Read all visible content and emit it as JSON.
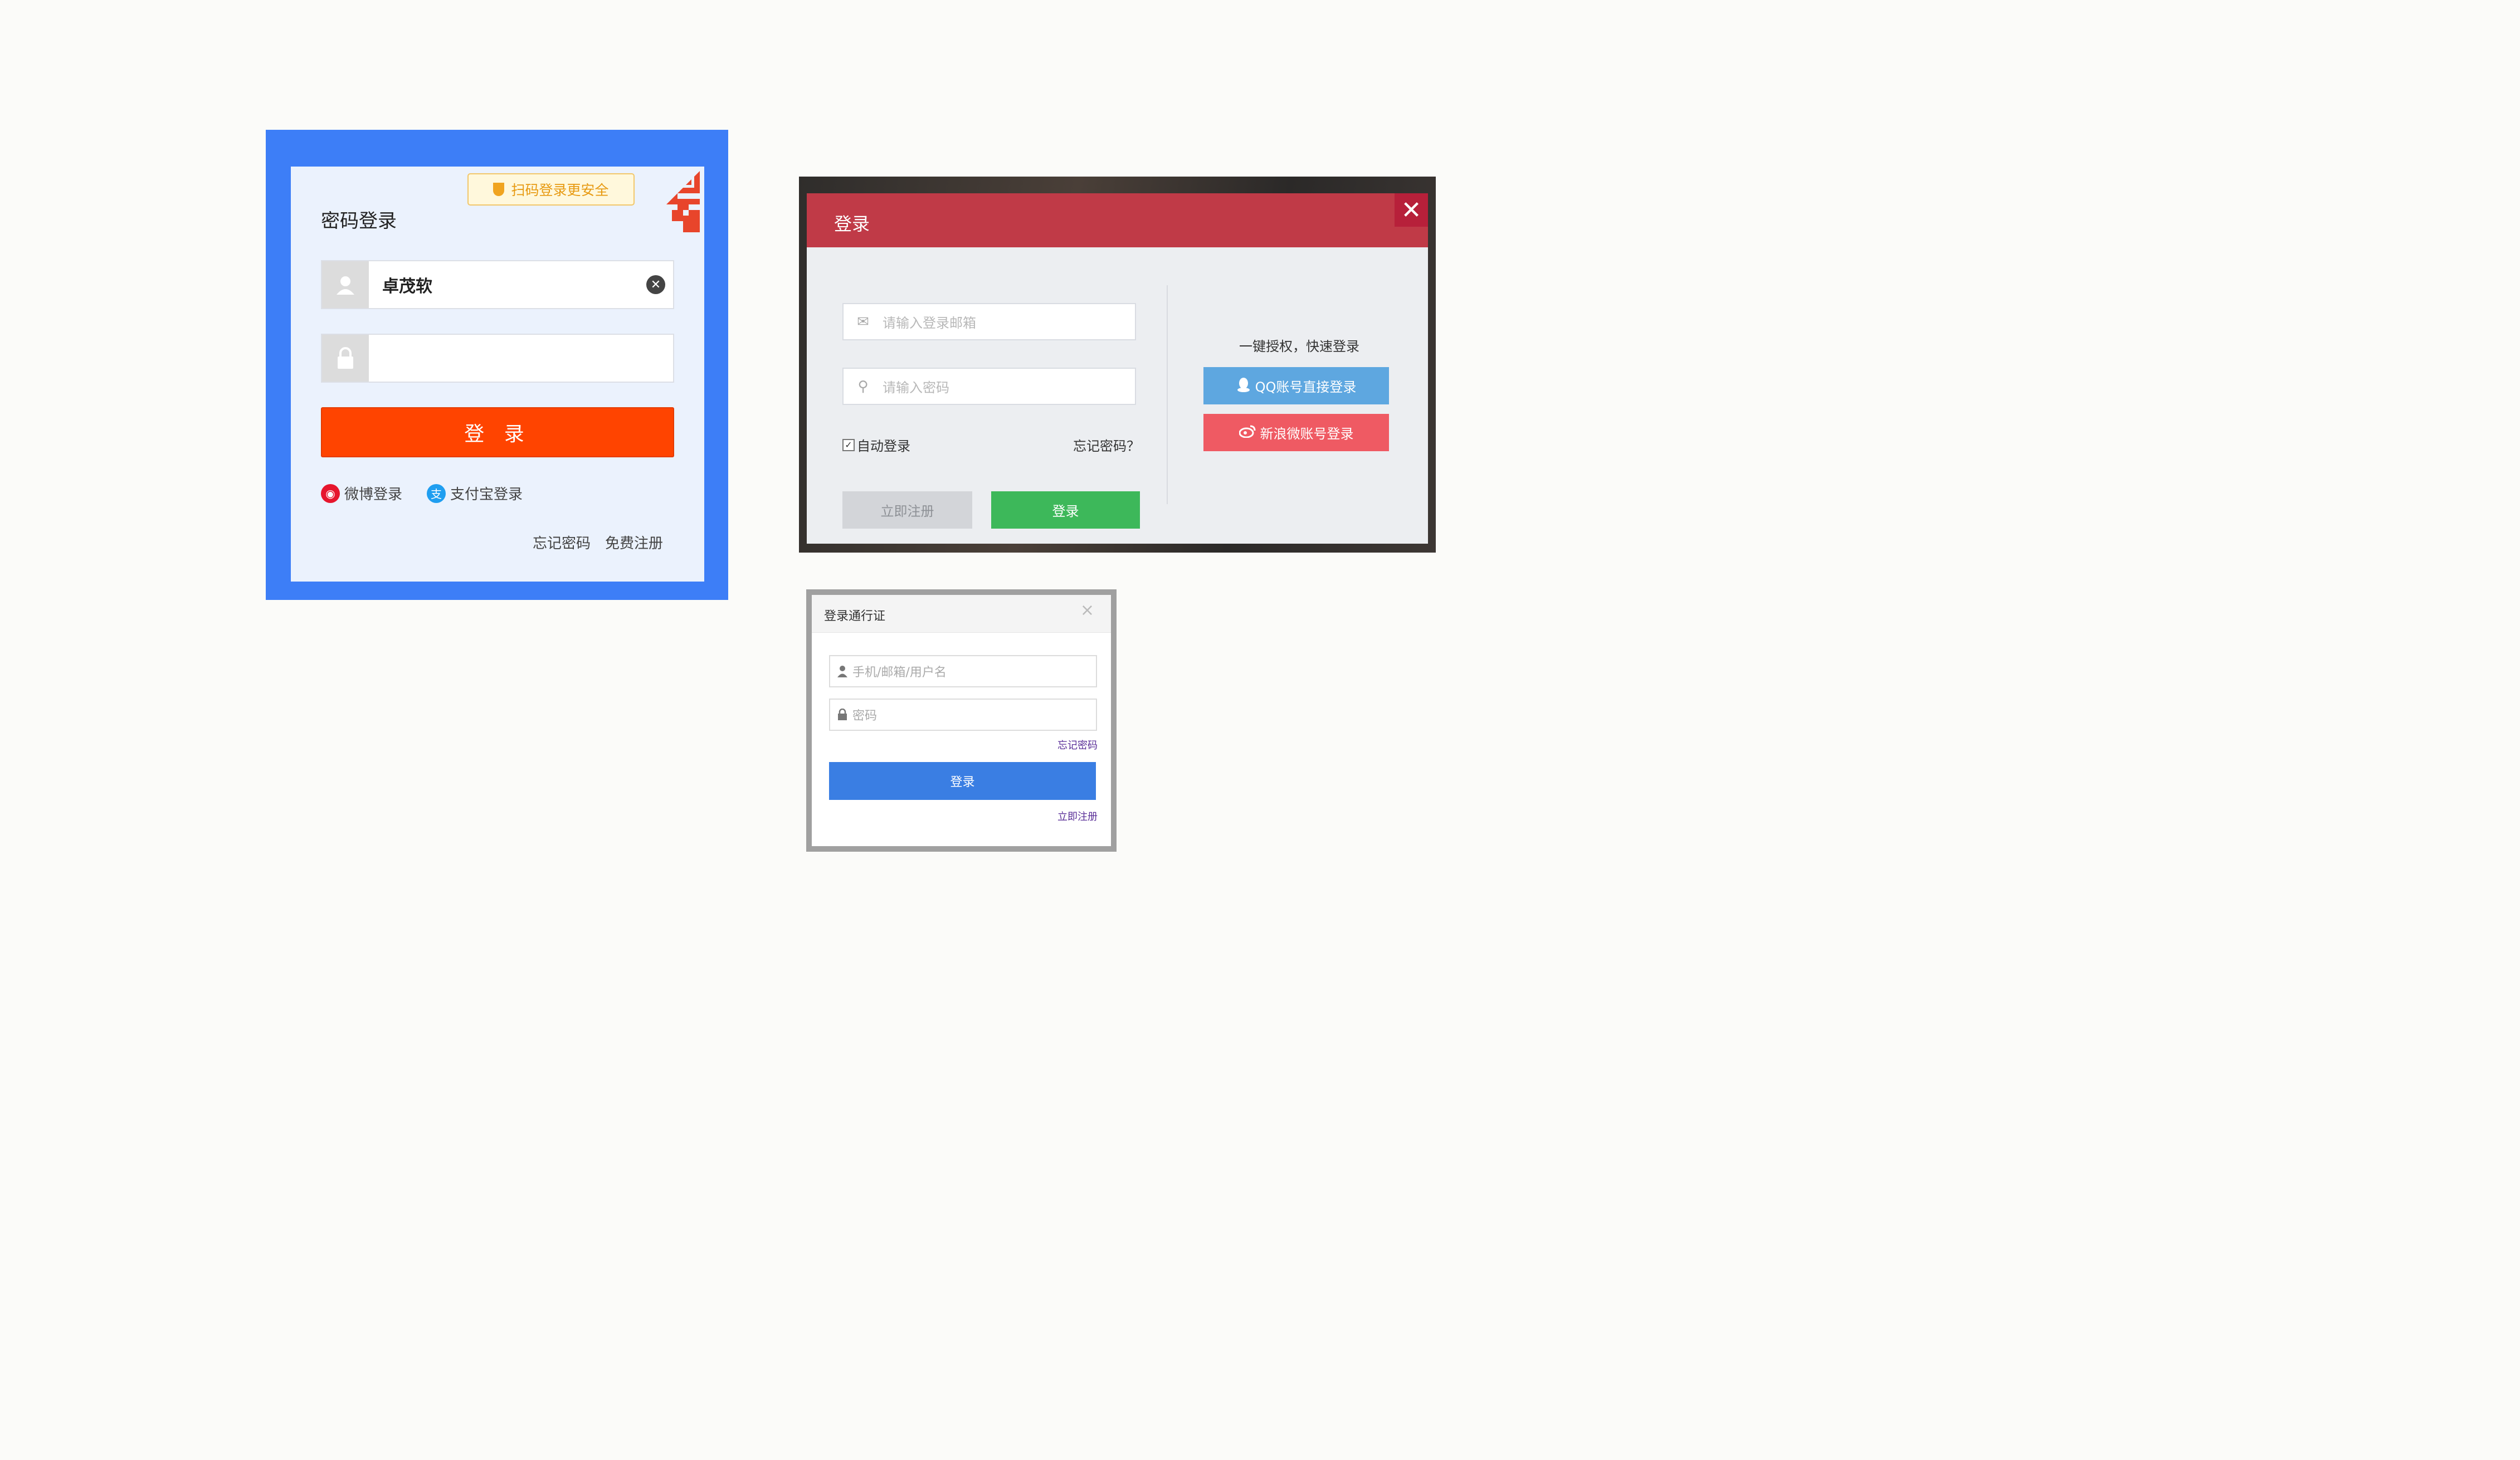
{
  "panel_a": {
    "title": "密码登录",
    "qr_tip": "扫码登录更安全",
    "username_value": "卓茂软",
    "password_value": "",
    "login_button": "登 录",
    "weibo_login": "微博登录",
    "alipay_login": "支付宝登录",
    "forgot_password": "忘记密码",
    "free_register": "免费注册",
    "colors": {
      "frame": "#3d7ef7",
      "button": "#ff4400"
    }
  },
  "panel_b": {
    "title": "登录",
    "close_icon": "close-icon",
    "email_placeholder": "请输入登录邮箱",
    "password_placeholder": "请输入密码",
    "auto_login": "自动登录",
    "forgot_password": "忘记密码？",
    "register_button": "立即注册",
    "login_button": "登录",
    "quick_login_text": "一键授权，快速登录",
    "qq_login": "QQ账号直接登录",
    "weibo_login": "新浪微账号登录",
    "colors": {
      "header": "#c03a47",
      "login": "#3db85a",
      "qq": "#5ea7e0",
      "weibo": "#ef5a63"
    }
  },
  "panel_c": {
    "title": "登录通行证",
    "close_icon": "close-icon",
    "username_placeholder": "手机/邮箱/用户名",
    "password_placeholder": "密码",
    "forgot_password": "忘记密码",
    "login_button": "登录",
    "register_now": "立即注册",
    "colors": {
      "button": "#3a7ee3"
    }
  }
}
